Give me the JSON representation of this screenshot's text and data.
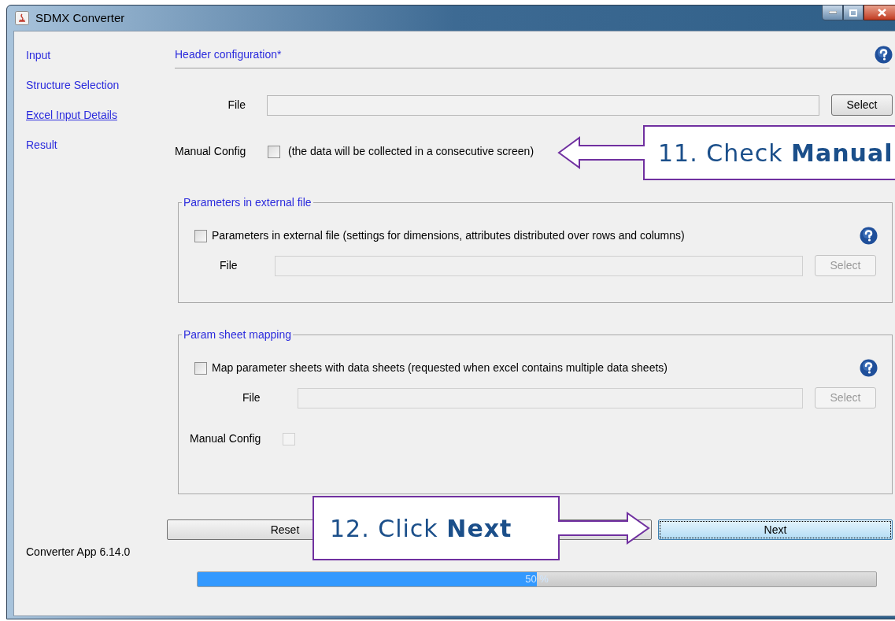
{
  "window": {
    "title": "SDMX Converter"
  },
  "sidebar": {
    "items": [
      {
        "label": "Input",
        "selected": false
      },
      {
        "label": "Structure Selection",
        "selected": false
      },
      {
        "label": "Excel Input Details",
        "selected": true
      },
      {
        "label": "Result",
        "selected": false
      }
    ],
    "version": "Converter App 6.14.0"
  },
  "header": {
    "title": "Header configuration*"
  },
  "file_row": {
    "label": "File",
    "button": "Select",
    "disabled": false
  },
  "manual_config": {
    "label": "Manual Config",
    "checked": false,
    "note": "(the data will be collected in a consecutive screen)"
  },
  "groups": [
    {
      "title": "Parameters in external file",
      "checkbox": {
        "label": "Parameters in external file (settings for dimensions, attributes distributed over rows and columns)",
        "checked": false
      },
      "file_label": "File",
      "button": "Select",
      "disabled": true
    },
    {
      "title": "Param sheet mapping",
      "checkbox": {
        "label": "Map parameter sheets with data sheets (requested when excel contains multiple data sheets)",
        "checked": false
      },
      "file_label": "File",
      "button": "Select",
      "disabled": true,
      "manual_config": {
        "label": "Manual Config",
        "checked": false,
        "disabled": true
      }
    }
  ],
  "buttons": [
    {
      "label": "Reset",
      "focused": false
    },
    {
      "label": "Next",
      "focused": true
    }
  ],
  "progress": {
    "level": 0.5,
    "reading": "50 %"
  },
  "callouts": [
    {
      "text": "11. Check **Manual**"
    },
    {
      "text": "12. Click **Next**"
    }
  ]
}
